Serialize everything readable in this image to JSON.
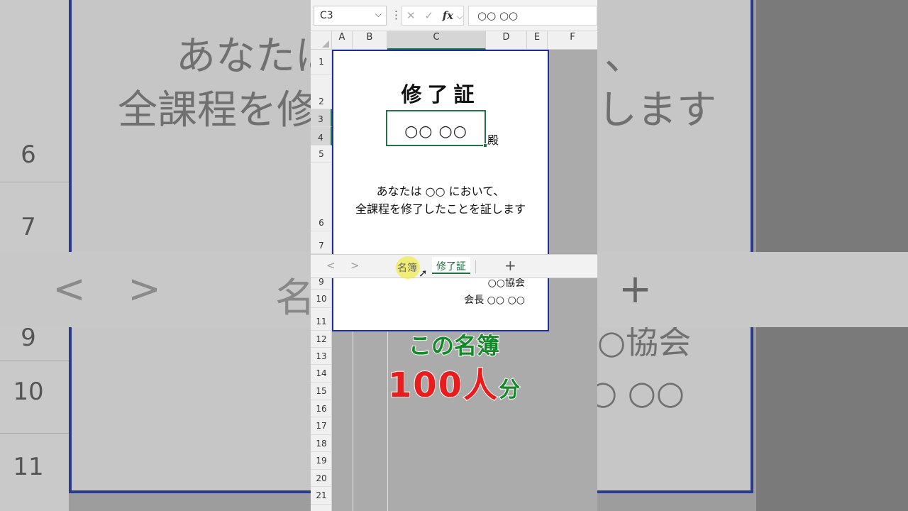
{
  "background": {
    "row_numbers": [
      "6",
      "7",
      "9",
      "10",
      "11"
    ],
    "text_line1": "あなたは",
    "text_line1_end": "、",
    "text_line2": "全課程を修",
    "text_line2_end": "します",
    "text_mid_right": "○協会",
    "text_low_right": "○ ○○",
    "tabbar_prev": "<",
    "tabbar_next": ">",
    "tabbar_tab": "名",
    "tabbar_plus": "+"
  },
  "formula_bar": {
    "name_box": "C3",
    "cancel_icon": "✕",
    "enter_icon": "✓",
    "fx_label": "fx",
    "content": "○○ ○○"
  },
  "columns": [
    "A",
    "B",
    "C",
    "D",
    "E",
    "F"
  ],
  "selected_column": "C",
  "rows": [
    "1",
    "2",
    "3",
    "4",
    "5",
    "6",
    "7",
    "9",
    "10",
    "11",
    "12",
    "13",
    "14",
    "15",
    "16",
    "17",
    "18",
    "19",
    "20",
    "21"
  ],
  "certificate": {
    "title": "修了証",
    "name": "○○ ○○",
    "honorific": "殿",
    "body_line1": "あなたは ○○ において、",
    "body_line2": "全課程を修了したことを証します",
    "org": "○○協会",
    "president": "会長 ○○ ○○"
  },
  "sheet_tabs": {
    "prev": "<",
    "next": ">",
    "tabs": [
      {
        "label": "名簿",
        "active": false
      },
      {
        "label": "修了証",
        "active": true
      }
    ],
    "add": "+"
  },
  "captions": {
    "line1": "この名簿",
    "line2_number": "100人",
    "line2_unit": "分"
  },
  "colors": {
    "excel_green": "#217346",
    "page_border": "#1f2f99",
    "caption_green": "#138a28",
    "caption_red": "#e81e1e"
  }
}
